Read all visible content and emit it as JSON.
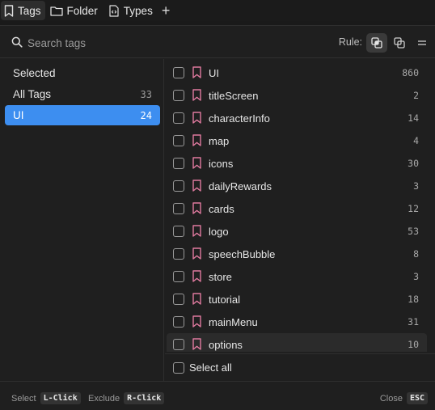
{
  "tabs": [
    {
      "label": "Tags",
      "icon": "bookmark-icon",
      "active": true
    },
    {
      "label": "Folder",
      "icon": "folder-icon",
      "active": false
    },
    {
      "label": "Types",
      "icon": "code-file-icon",
      "active": false
    }
  ],
  "add_tab_label": "+",
  "search": {
    "placeholder": "Search tags",
    "value": ""
  },
  "rule": {
    "label": "Rule:",
    "options": [
      "intersect-icon",
      "union-icon",
      "equals-icon"
    ],
    "selected": 0
  },
  "left": {
    "items": [
      {
        "label": "Selected",
        "count": ""
      },
      {
        "label": "All Tags",
        "count": "33"
      },
      {
        "label": "UI",
        "count": "24",
        "active": true
      }
    ]
  },
  "tags": [
    {
      "label": "UI",
      "count": "860"
    },
    {
      "label": "titleScreen",
      "count": "2"
    },
    {
      "label": "characterInfo",
      "count": "14"
    },
    {
      "label": "map",
      "count": "4"
    },
    {
      "label": "icons",
      "count": "30"
    },
    {
      "label": "dailyRewards",
      "count": "3"
    },
    {
      "label": "cards",
      "count": "12"
    },
    {
      "label": "logo",
      "count": "53"
    },
    {
      "label": "speechBubble",
      "count": "8"
    },
    {
      "label": "store",
      "count": "3"
    },
    {
      "label": "tutorial",
      "count": "18"
    },
    {
      "label": "mainMenu",
      "count": "31"
    },
    {
      "label": "options",
      "count": "10"
    }
  ],
  "select_all_label": "Select all",
  "footer": {
    "select_label": "Select",
    "select_key": "L-Click",
    "exclude_label": "Exclude",
    "exclude_key": "R-Click",
    "close_label": "Close",
    "close_key": "ESC"
  },
  "colors": {
    "accent": "#3d8ef0",
    "bookmark": "#e07a9f"
  }
}
